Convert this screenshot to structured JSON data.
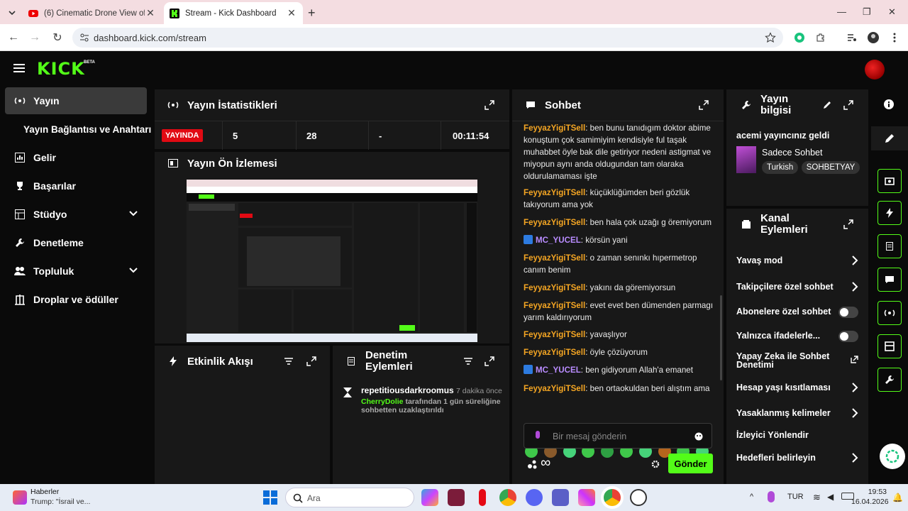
{
  "browser": {
    "tabs": [
      {
        "title": "(6) Cinematic Drone View of Lo",
        "favicon": "youtube-icon",
        "active": false
      },
      {
        "title": "Stream - Kick Dashboard",
        "favicon": "kick-icon",
        "active": true
      }
    ],
    "url": "dashboard.kick.com/stream"
  },
  "brand": {
    "logo": "KICK",
    "badge": "BETA",
    "accent": "#53fc18"
  },
  "sidebar": {
    "items": [
      {
        "label": "Yayın",
        "icon": "broadcast-icon",
        "active": true
      },
      {
        "label": "Yayın Bağlantısı ve Anahtarı",
        "icon": "",
        "active": false
      },
      {
        "label": "Gelir",
        "icon": "chart-icon",
        "active": false
      },
      {
        "label": "Başarılar",
        "icon": "trophy-icon",
        "active": false
      },
      {
        "label": "Stüdyo",
        "icon": "grid-icon",
        "active": false,
        "expandable": true
      },
      {
        "label": "Denetleme",
        "icon": "wrench-icon",
        "active": false
      },
      {
        "label": "Topluluk",
        "icon": "people-icon",
        "active": false,
        "expandable": true
      },
      {
        "label": "Droplar ve ödüller",
        "icon": "gift-icon",
        "active": false
      }
    ]
  },
  "stats": {
    "title": "Yayın İstatistikleri",
    "live_label": "YAYINDA",
    "viewers": "5",
    "followers": "28",
    "subs": "-",
    "uptime": "00:11:54"
  },
  "preview": {
    "title": "Yayın Ön İzlemesi"
  },
  "activity": {
    "title": "Etkinlik Akışı"
  },
  "mod_actions": {
    "title": "Denetim Eylemleri",
    "entries": [
      {
        "user": "repetitiousdarkroomus",
        "time": "7 dakika önce",
        "actor": "CherryDolie",
        "text": "tarafından 1 gün süreliğine sohbetten uzaklaştırıldı"
      }
    ]
  },
  "chat": {
    "title": "Sohbet",
    "messages": [
      {
        "user": "FeyyazYigiTSell",
        "text": "ben bunu tanıdıgım doktor abime konuştum çok samimiyim kendisiyle ful taşak muhabbet öyle bak dile getiriyor nedeni astigmat ve miyopun aynı anda oldugundan tam olaraka oldurulamaması işte",
        "mod": false
      },
      {
        "user": "FeyyazYigiTSell",
        "text": "küçüklüğümden beri gözlük takıyorum ama yok",
        "mod": false
      },
      {
        "user": "FeyyazYigiTSell",
        "text": "ben hala çok uzağı g öremiyorum",
        "mod": false
      },
      {
        "user": "MC_YUCEL",
        "text": "körsün yani",
        "mod": true
      },
      {
        "user": "FeyyazYigiTSell",
        "text": "o zaman senınkı hıpermetrop canım benim",
        "mod": false
      },
      {
        "user": "FeyyazYigiTSell",
        "text": "yakını da göremiyorsun",
        "mod": false
      },
      {
        "user": "FeyyazYigiTSell",
        "text": "evet evet ben dümenden parmagı yarım kaldırıyorum",
        "mod": false
      },
      {
        "user": "FeyyazYigiTSell",
        "text": "yavaşlıyor",
        "mod": false
      },
      {
        "user": "FeyyazYigiTSell",
        "text": "öyle çözüyorum",
        "mod": false
      },
      {
        "user": "MC_YUCEL",
        "text": "ben gidiyorum Allah'a emanet",
        "mod": true
      },
      {
        "user": "FeyyazYigiTSell",
        "text": "ben ortaokuldan beri alıştım ama",
        "mod": false
      }
    ],
    "input_placeholder": "Bir mesaj gönderin",
    "send_label": "Gönder",
    "infinity": "∞"
  },
  "stream_info": {
    "title": "Yayın bilgisi",
    "stream_title": "acemi yayıncınız geldi",
    "category": "Sadece Sohbet",
    "tags": [
      "Turkish",
      "SOHBETYAY"
    ]
  },
  "channel_actions": {
    "title": "Kanal Eylemleri",
    "items": [
      {
        "label": "Yavaş mod",
        "control": "chevron"
      },
      {
        "label": "Takipçilere özel sohbet",
        "control": "chevron"
      },
      {
        "label": "Abonelere özel sohbet",
        "control": "toggle"
      },
      {
        "label": "Yalnızca ifadelerle...",
        "control": "toggle"
      },
      {
        "label": "Yapay Zeka ile Sohbet Denetimi",
        "control": "external"
      },
      {
        "label": "Hesap yaşı kısıtlaması",
        "control": "chevron"
      },
      {
        "label": "Yasaklanmış kelimeler",
        "control": "chevron"
      },
      {
        "label": "İzleyici Yönlendir",
        "control": "none"
      },
      {
        "label": "Hedefleri belirleyin",
        "control": "chevron"
      }
    ]
  },
  "taskbar": {
    "news_title": "Haberler",
    "news_sub": "Trump: \"İsrail ve...",
    "search_placeholder": "Ara",
    "lang": "TUR",
    "time": "19:53",
    "date": "16.04.2026"
  }
}
